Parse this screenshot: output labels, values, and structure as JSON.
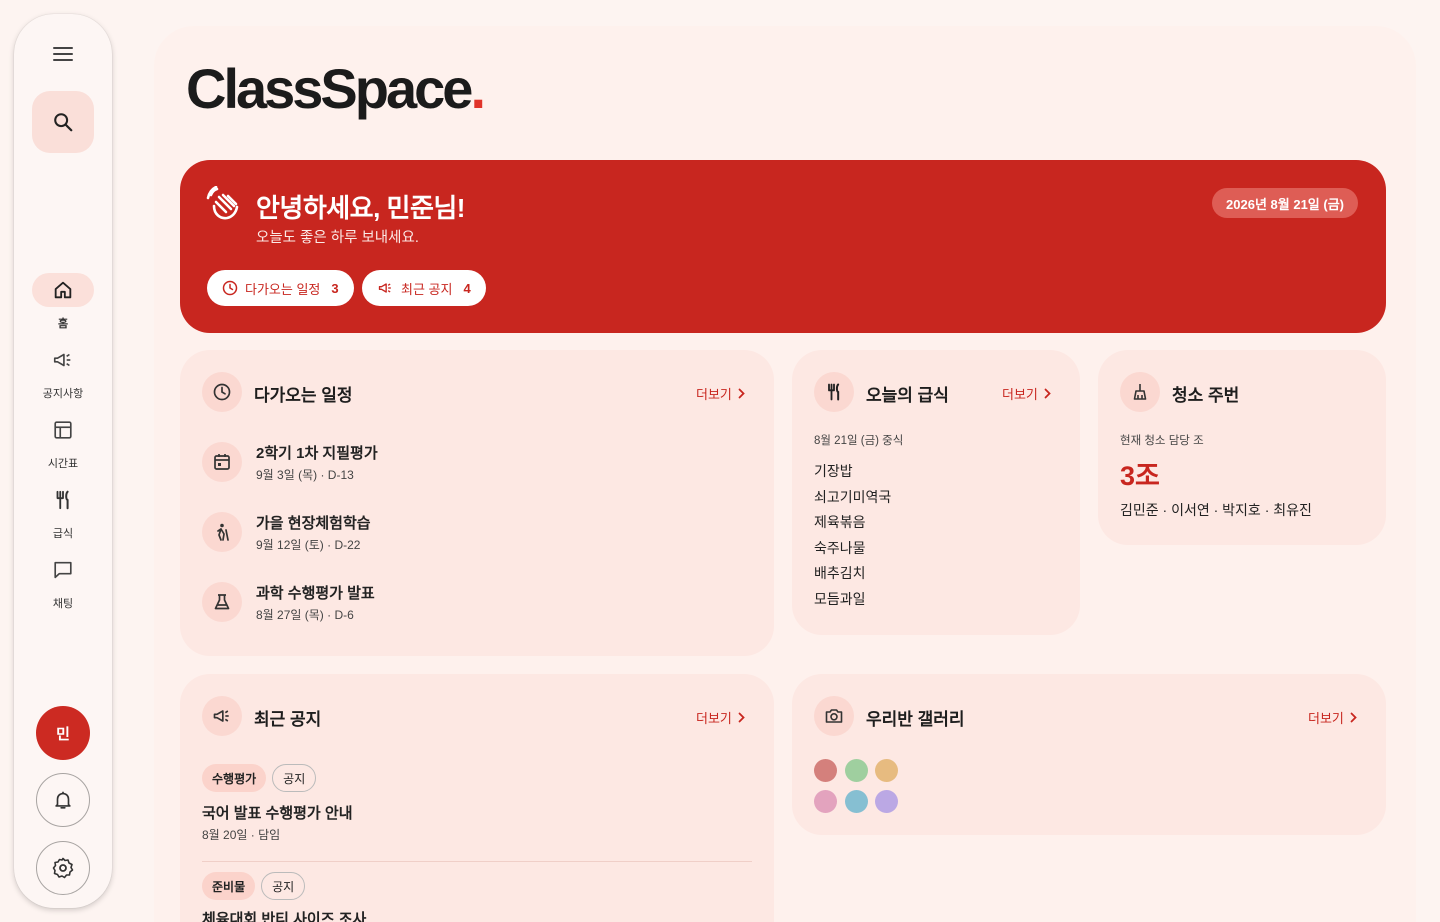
{
  "sidebar": {
    "nav": [
      {
        "label": "홈",
        "icon": "home-icon"
      },
      {
        "label": "공지사항",
        "icon": "megaphone-icon"
      },
      {
        "label": "시간표",
        "icon": "calendar-grid-icon"
      },
      {
        "label": "급식",
        "icon": "utensils-icon"
      },
      {
        "label": "채팅",
        "icon": "chat-icon"
      }
    ],
    "avatar_initial": "민"
  },
  "logo": {
    "text": "ClassSpace",
    "dot": "."
  },
  "hero": {
    "title": "안녕하세요, 민준님!",
    "subtitle": "오늘도 좋은 하루 보내세요.",
    "date": "2026년 8월 21일 (금)",
    "pills": [
      {
        "label": "다가오는 일정",
        "count": "3"
      },
      {
        "label": "최근 공지",
        "count": "4"
      }
    ]
  },
  "upcoming": {
    "title": "다가오는 일정",
    "more": "더보기",
    "events": [
      {
        "title": "2학기 1차 지필평가",
        "date": "9월 3일 (목) · D-13",
        "icon": "calendar-icon"
      },
      {
        "title": "가을 현장체험학습",
        "date": "9월 12일 (토) · D-22",
        "icon": "hiking-icon"
      },
      {
        "title": "과학 수행평가 발표",
        "date": "8월 27일 (목) · D-6",
        "icon": "flask-icon"
      }
    ]
  },
  "meal": {
    "title": "오늘의 급식",
    "more": "더보기",
    "date": "8월 21일 (금) 중식",
    "items": [
      "기장밥",
      "쇠고기미역국",
      "제육볶음",
      "숙주나물",
      "배추김치",
      "모듬과일"
    ]
  },
  "cleaning": {
    "title": "청소 주번",
    "label": "현재 청소 담당 조",
    "group": "3조",
    "members": "김민준 · 이서연 · 박지호 · 최유진"
  },
  "notices": {
    "title": "최근 공지",
    "more": "더보기",
    "items": [
      {
        "tags": [
          "수행평가",
          "공지"
        ],
        "title": "국어 발표 수행평가 안내",
        "meta": "8월 20일 · 담임"
      },
      {
        "tags": [
          "준비물",
          "공지"
        ],
        "title": "체육대회 반티 사이즈 조사",
        "meta": ""
      }
    ]
  },
  "gallery": {
    "title": "우리반 갤러리",
    "more": "더보기",
    "swatches": [
      "#d4807c",
      "#9fcf9f",
      "#e7bb80",
      "#e3a3be",
      "#86bfd2",
      "#bba8e4"
    ]
  },
  "colors": {
    "accent": "#c8261f",
    "background": "#fdf4f1"
  }
}
